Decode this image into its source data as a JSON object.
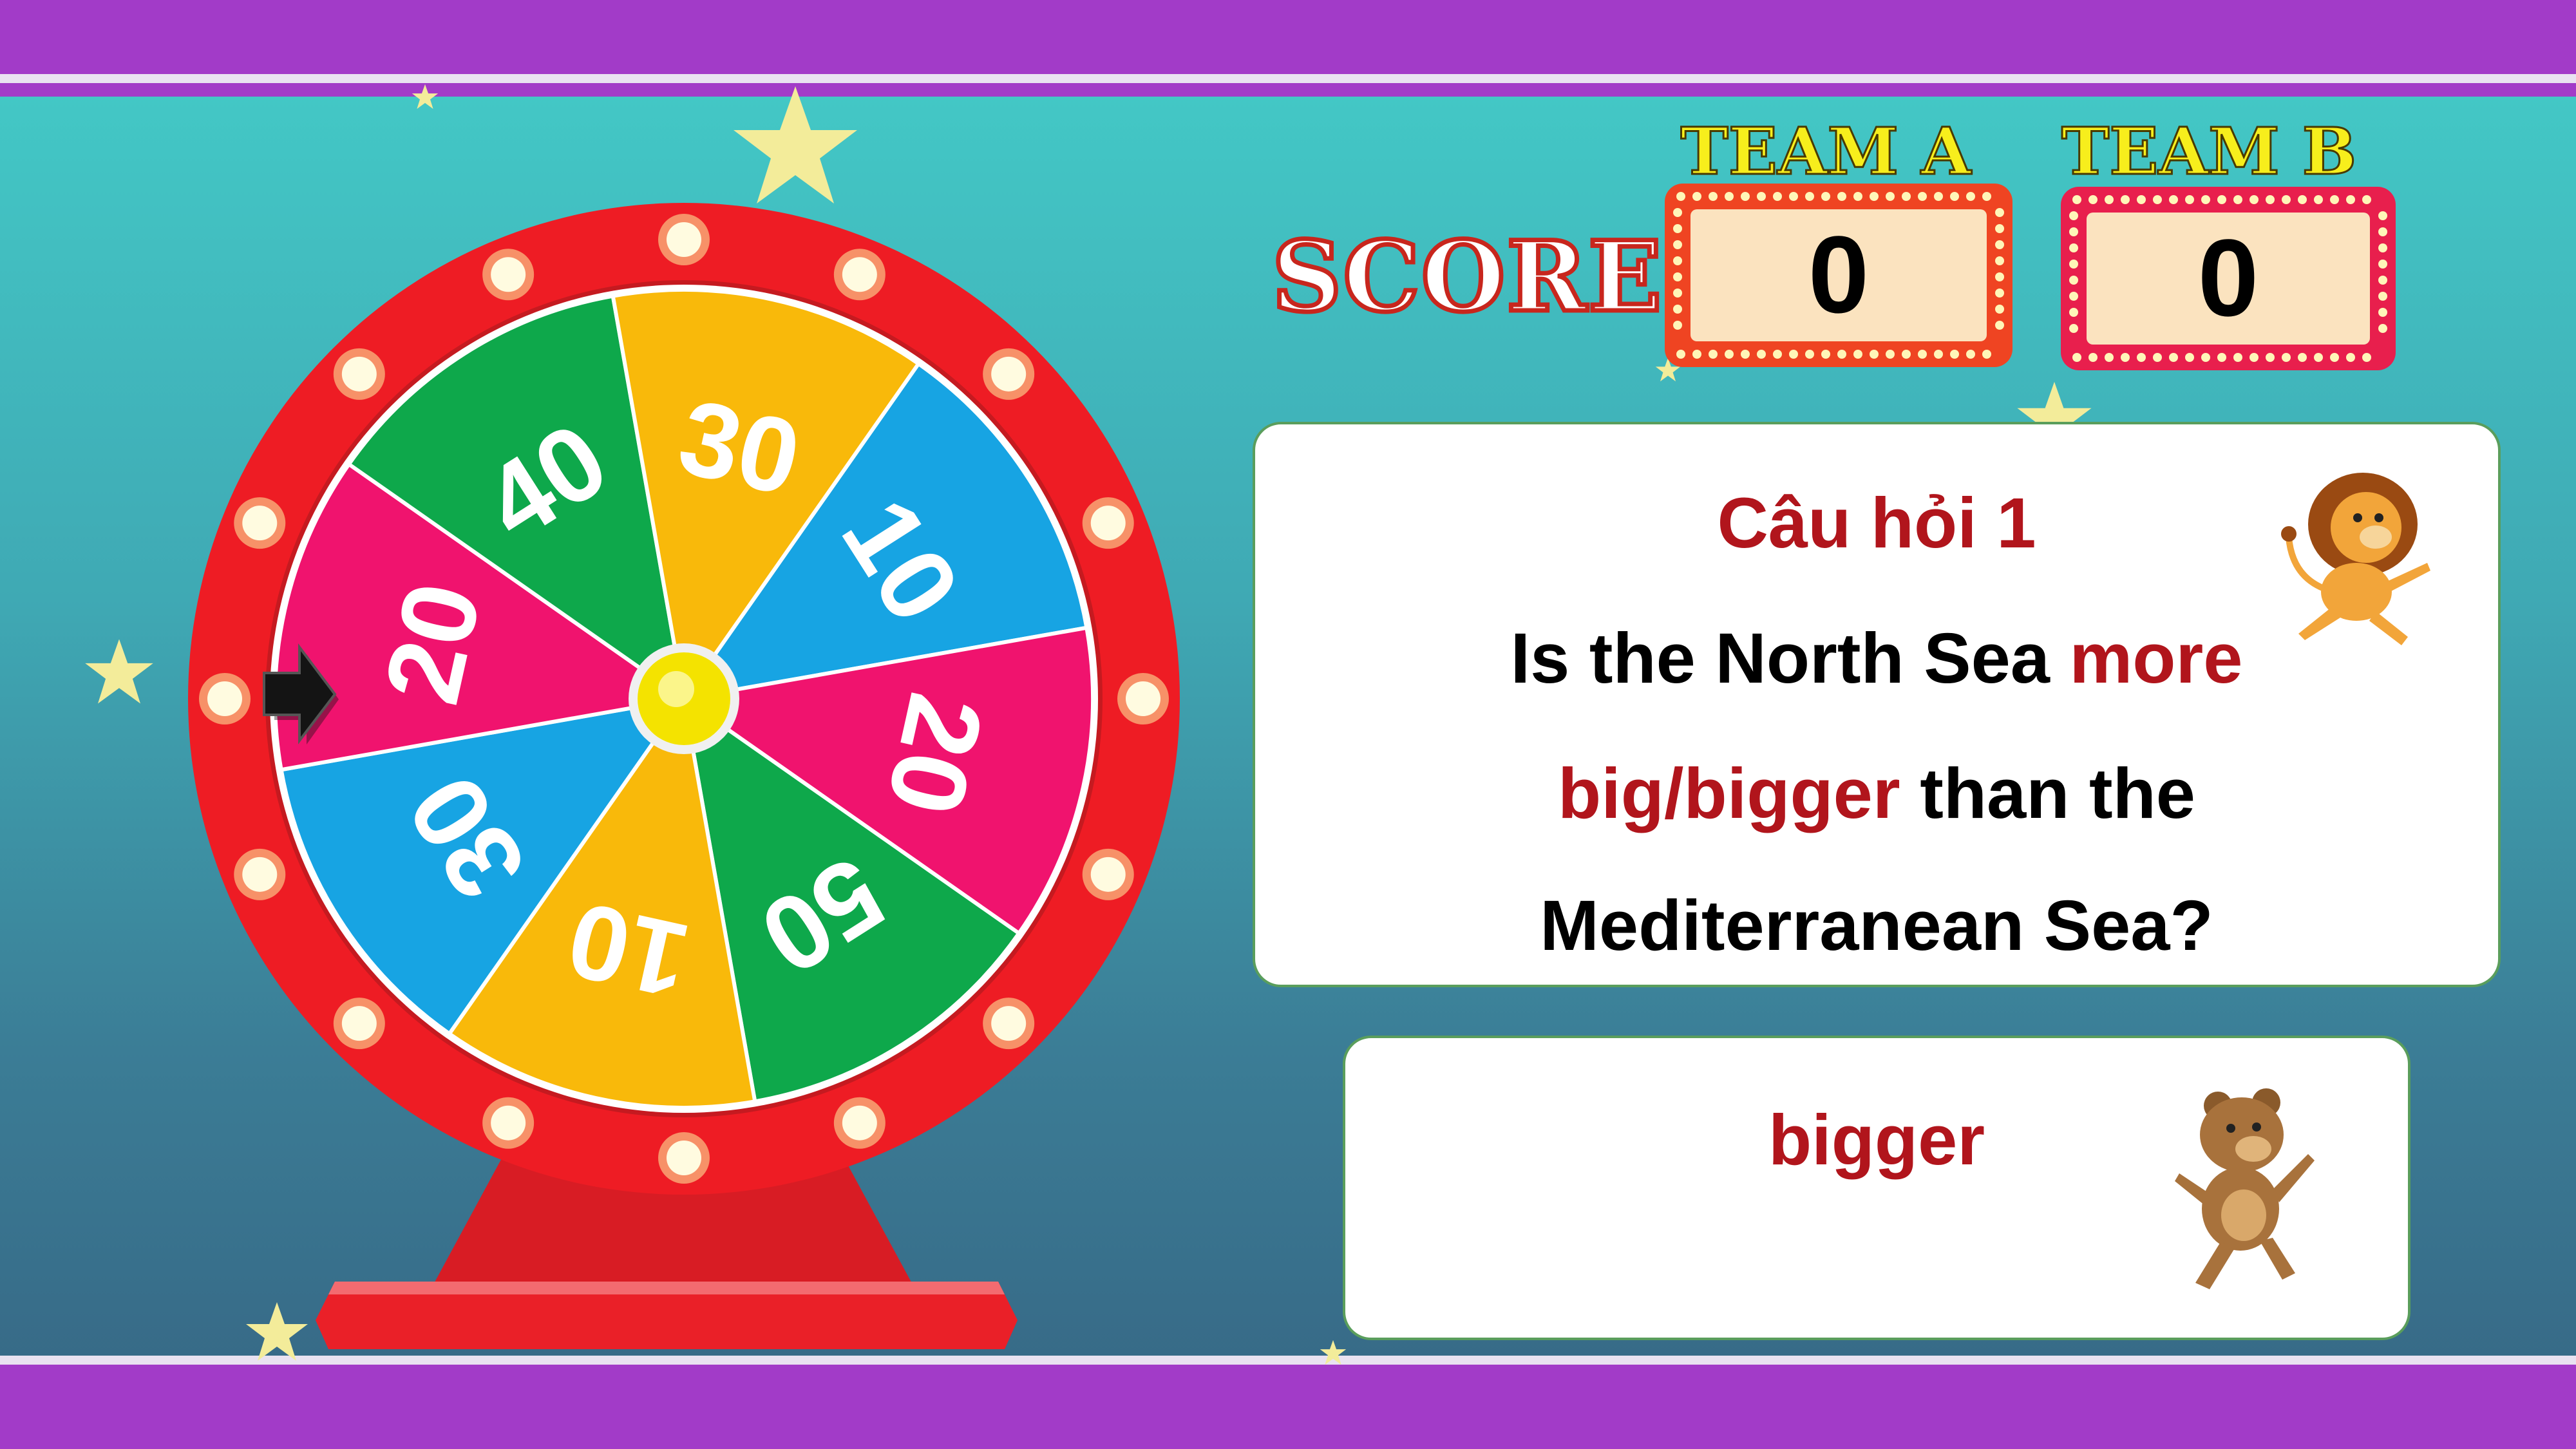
{
  "scoreboard": {
    "title": "SCORE",
    "teams": [
      {
        "name": "TEAM A",
        "score": "0"
      },
      {
        "name": "TEAM B",
        "score": "0"
      }
    ]
  },
  "wheel": {
    "segments": [
      "10",
      "20",
      "50",
      "10",
      "30",
      "20",
      "40",
      "30"
    ],
    "colors": [
      "#17a4e3",
      "#f0136e",
      "#0ea84b",
      "#f9b90a",
      "#17a4e3",
      "#f0136e",
      "#0ea84b",
      "#f9b90a"
    ],
    "rim_color": "#ed1c24",
    "hub_color": "#f4e300",
    "pointer_icon": "arrow-right-icon"
  },
  "question": {
    "title": "Câu hỏi 1",
    "line1_pre": "Is the North Sea ",
    "line1_hl": "more",
    "line2_hl": "big/bigger",
    "line2_post": " than the",
    "line3": "Mediterranean Sea?",
    "mascot_icon": "lion-icon"
  },
  "answer": {
    "text": "bigger",
    "mascot_icon": "bear-icon"
  }
}
